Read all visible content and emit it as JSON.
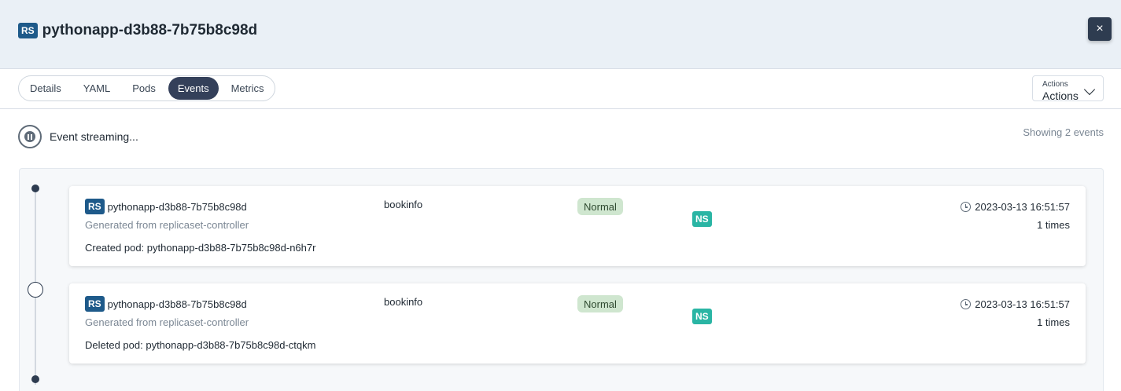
{
  "header": {
    "kind_badge": "RS",
    "title": "pythonapp-d3b88-7b75b8c98d",
    "close_icon": "×"
  },
  "tabs": [
    {
      "label": "Details"
    },
    {
      "label": "YAML"
    },
    {
      "label": "Pods"
    },
    {
      "label": "Events",
      "active": true
    },
    {
      "label": "Metrics"
    }
  ],
  "actions": {
    "label": "Actions",
    "value": "Actions"
  },
  "stream": {
    "status": "Event streaming...",
    "count_text": "Showing 2 events"
  },
  "events": [
    {
      "kind_badge": "RS",
      "object": "pythonapp-d3b88-7b75b8c98d",
      "ns_badge": "NS",
      "namespace": "bookinfo",
      "type": "Normal",
      "source": "Generated from replicaset-controller",
      "message": "Created pod: pythonapp-d3b88-7b75b8c98d-n6h7r",
      "timestamp": "2023-03-13 16:51:57",
      "count": "1 times"
    },
    {
      "kind_badge": "RS",
      "object": "pythonapp-d3b88-7b75b8c98d",
      "ns_badge": "NS",
      "namespace": "bookinfo",
      "type": "Normal",
      "source": "Generated from replicaset-controller",
      "message": "Deleted pod: pythonapp-d3b88-7b75b8c98d-ctqkm",
      "timestamp": "2023-03-13 16:51:57",
      "count": "1 times"
    }
  ],
  "colors": {
    "rs_badge": "#1e5a8a",
    "ns_badge": "#2ab5a4",
    "active_tab": "#34405a",
    "normal_pill": "#cfe6cf"
  }
}
